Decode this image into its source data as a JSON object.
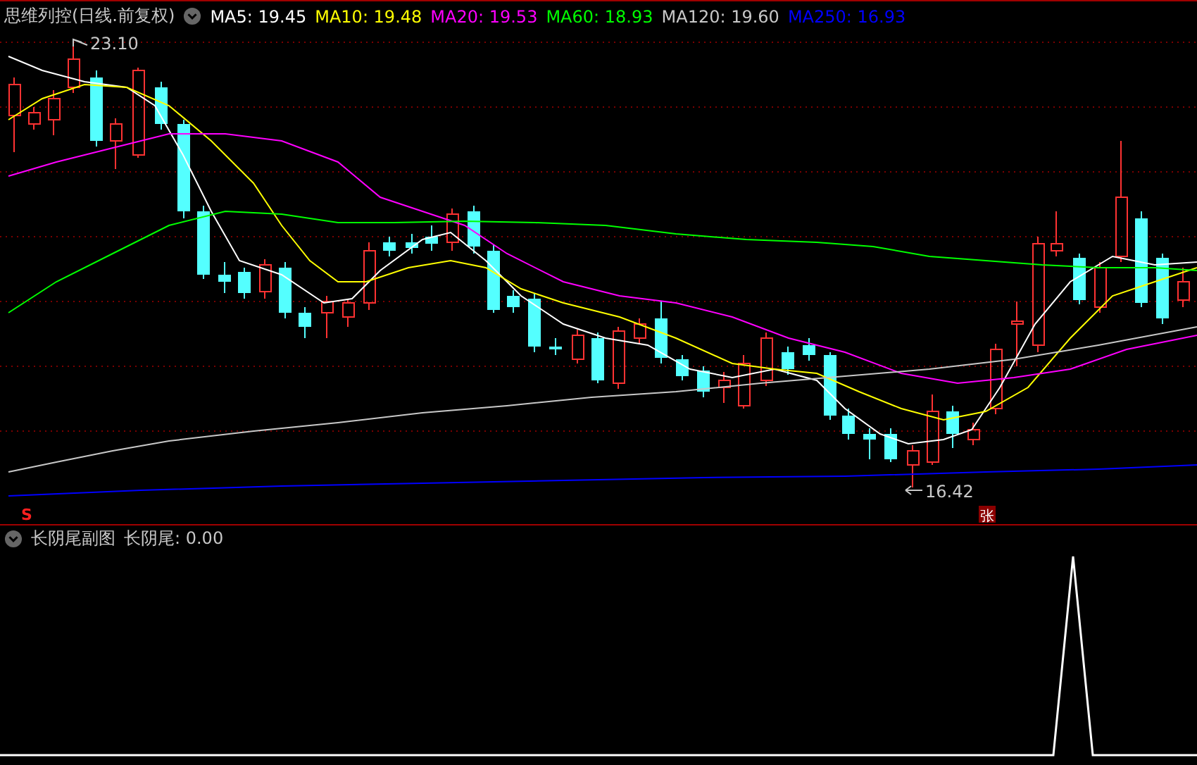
{
  "main_chart": {
    "title": "思维列控(日线.前复权)",
    "indicators": [
      {
        "label": "MA5: 19.45",
        "color": "#ffffff"
      },
      {
        "label": "MA10: 19.48",
        "color": "#ffff00"
      },
      {
        "label": "MA20: 19.53",
        "color": "#ff00ff"
      },
      {
        "label": "MA60: 18.93",
        "color": "#00ff00"
      },
      {
        "label": "MA120: 19.60",
        "color": "#c8c8c8"
      },
      {
        "label": "MA250: 16.93",
        "color": "#0000ff"
      }
    ],
    "high_label": "23.10",
    "low_label": "16.42",
    "signal_marker": "S",
    "event_marker": "张"
  },
  "sub_chart": {
    "title": "长阴尾副图",
    "reading": "长阴尾: 0.00"
  }
}
